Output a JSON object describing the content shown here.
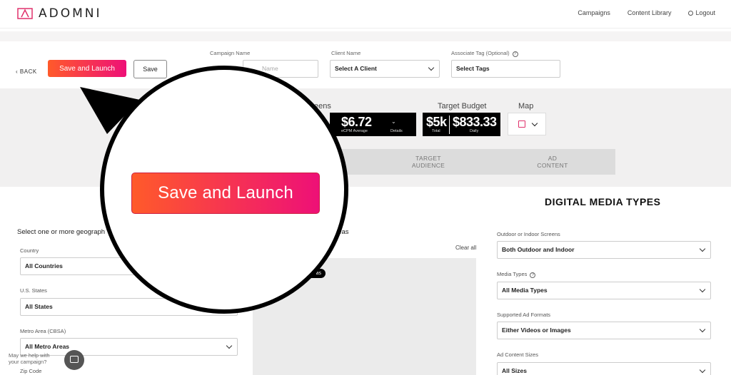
{
  "brand": {
    "name": "ADOMNI",
    "accent": "#e0306b"
  },
  "nav": {
    "campaigns": "Campaigns",
    "content_library": "Content Library",
    "logout": "Logout"
  },
  "toolbar": {
    "back": "BACK",
    "save_launch": "Save and Launch",
    "save": "Save",
    "campaign_name_label": "Campaign Name",
    "campaign_name_placeholder": "Name",
    "client_name_label": "Client Name",
    "client_value": "Select A Client",
    "tag_label": "Associate Tag (Optional)",
    "tag_value": "Select Tags"
  },
  "stats": {
    "screens_label": "eens",
    "ecpm_value": "$6.72",
    "ecpm_caption": "eCPM Average",
    "details": "Details",
    "budget_label": "Target Budget",
    "budget_total": "$5k",
    "budget_total_caption": "Total",
    "budget_daily": "$833.33",
    "budget_daily_caption": "Daily",
    "map_label": "Map"
  },
  "tabs": {
    "target_audience_1": "TARGET",
    "target_audience_2": "AUDIENCE",
    "ad_content_1": "AD",
    "ad_content_2": "CONTENT"
  },
  "geo": {
    "title": "Select one or more geograph",
    "areas_suffix": "reas",
    "clear_all": "Clear all",
    "map_tag": "as",
    "country_label": "Country",
    "country_value": "All Countries",
    "states_label": "U.S. States",
    "states_value": "All States",
    "metro_label": "Metro Area (CBSA)",
    "metro_value": "All Metro Areas",
    "zip_label": "Zip Code"
  },
  "media": {
    "title": "DIGITAL MEDIA TYPES",
    "screens_label": "Outdoor or Indoor Screens",
    "screens_value": "Both Outdoor and Indoor",
    "types_label": "Media Types",
    "types_value": "All Media Types",
    "formats_label": "Supported Ad Formats",
    "formats_value": "Either Videos or Images",
    "sizes_label": "Ad Content Sizes",
    "sizes_value": "All Sizes"
  },
  "chat": {
    "line1": "May we help with",
    "line2": "your campaign?"
  },
  "magnifier": {
    "save_launch": "Save and Launch"
  }
}
